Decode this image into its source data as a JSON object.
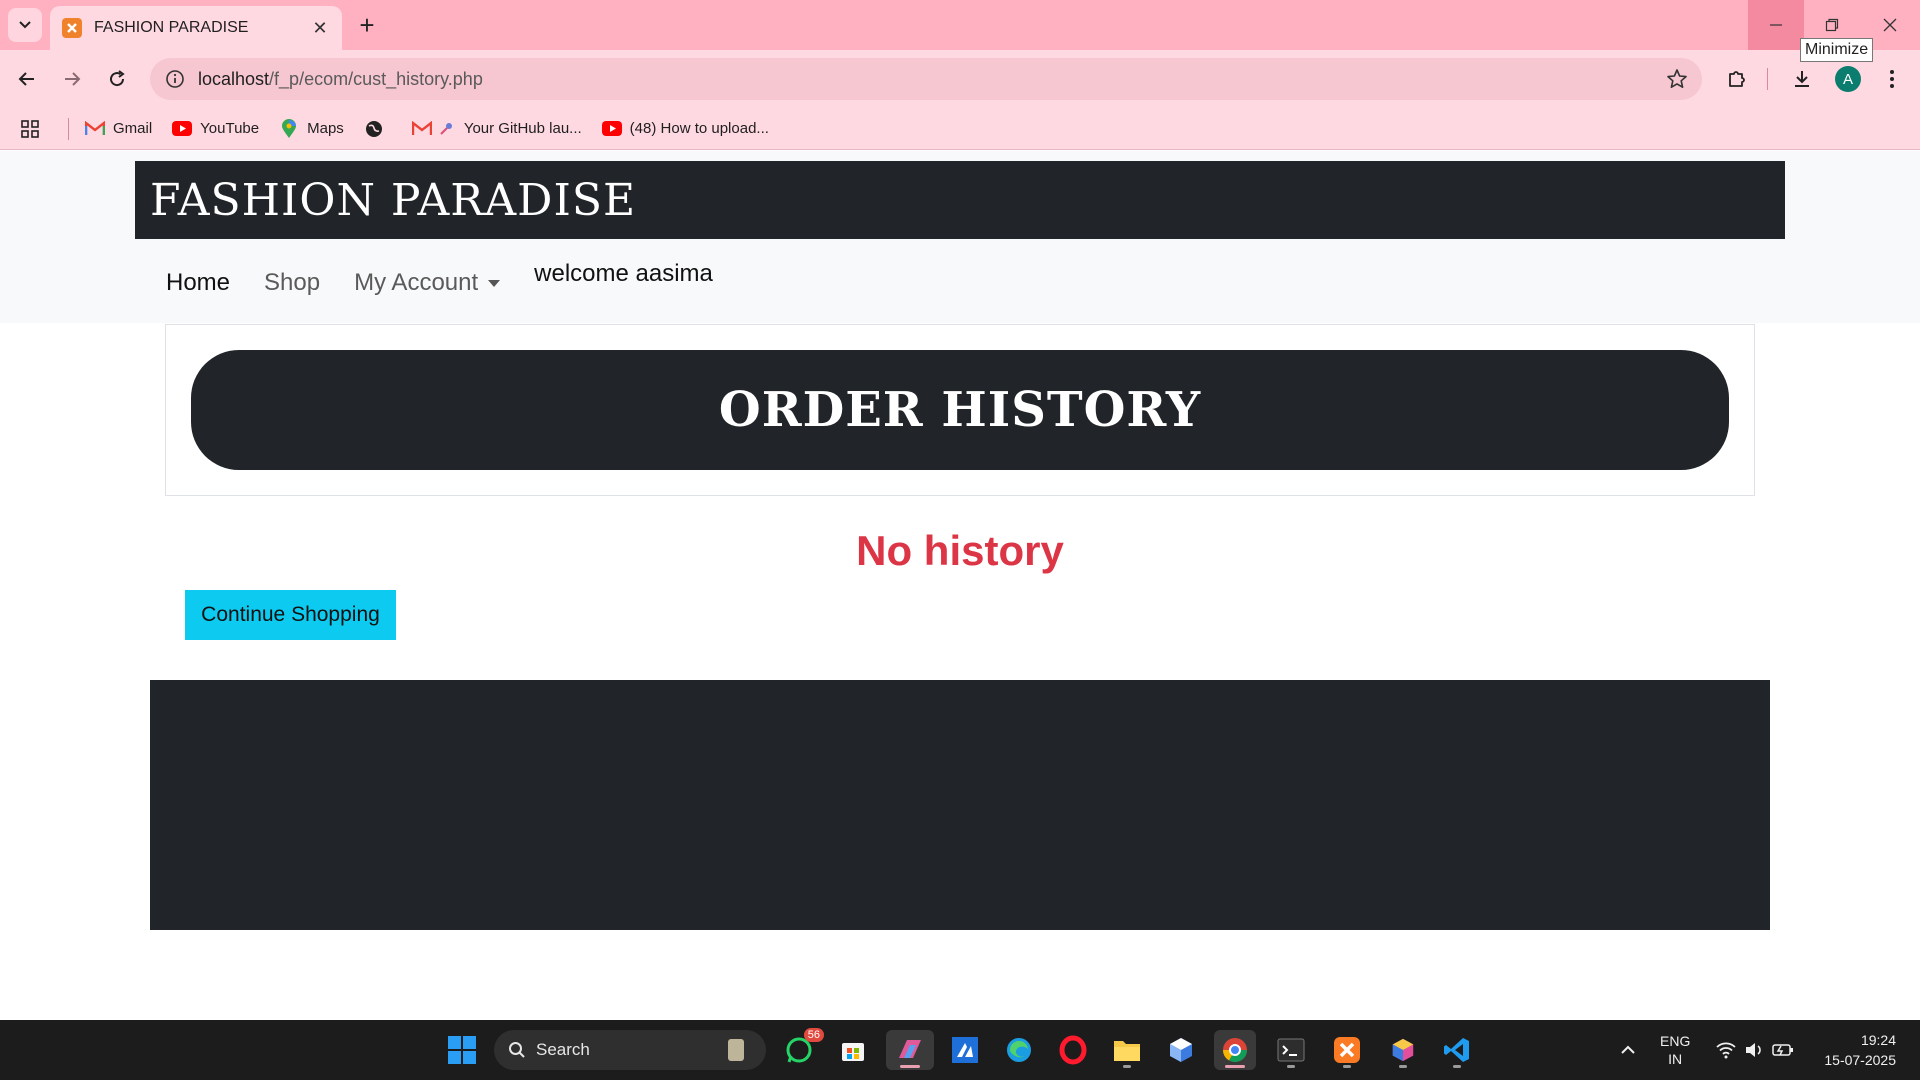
{
  "browser": {
    "tab_title": "FASHION PARADISE",
    "url_host": "localhost",
    "url_path": "/f_p/ecom/cust_history.php",
    "tooltip": "Minimize",
    "profile_initial": "A",
    "bookmarks": [
      {
        "label": "Gmail",
        "icon": "gmail-icon"
      },
      {
        "label": "YouTube",
        "icon": "youtube-icon"
      },
      {
        "label": "Maps",
        "icon": "maps-icon"
      },
      {
        "label": "",
        "icon": "globe-icon"
      },
      {
        "label": "Your GitHub lau...",
        "icon": "github-launch-icon"
      },
      {
        "label": "(48) How to upload...",
        "icon": "youtube-icon"
      }
    ]
  },
  "site": {
    "brand": "FASHION PARADISE",
    "nav": {
      "home": "Home",
      "shop": "Shop",
      "account": "My Account",
      "welcome": "welcome aasima"
    },
    "history_title": "ORDER HISTORY",
    "empty_message": "No history",
    "continue_label": "Continue Shopping"
  },
  "taskbar": {
    "search_label": "Search",
    "whatsapp_badge": "56",
    "language_line1": "ENG",
    "language_line2": "IN",
    "time": "19:24",
    "date": "15-07-2025"
  },
  "colors": {
    "browser_frame": "#ffb1c1",
    "browser_toolbar": "#ffd9e1",
    "dark_bar": "#212529",
    "danger_text": "#dc3545",
    "info_button": "#0dcaf0"
  }
}
